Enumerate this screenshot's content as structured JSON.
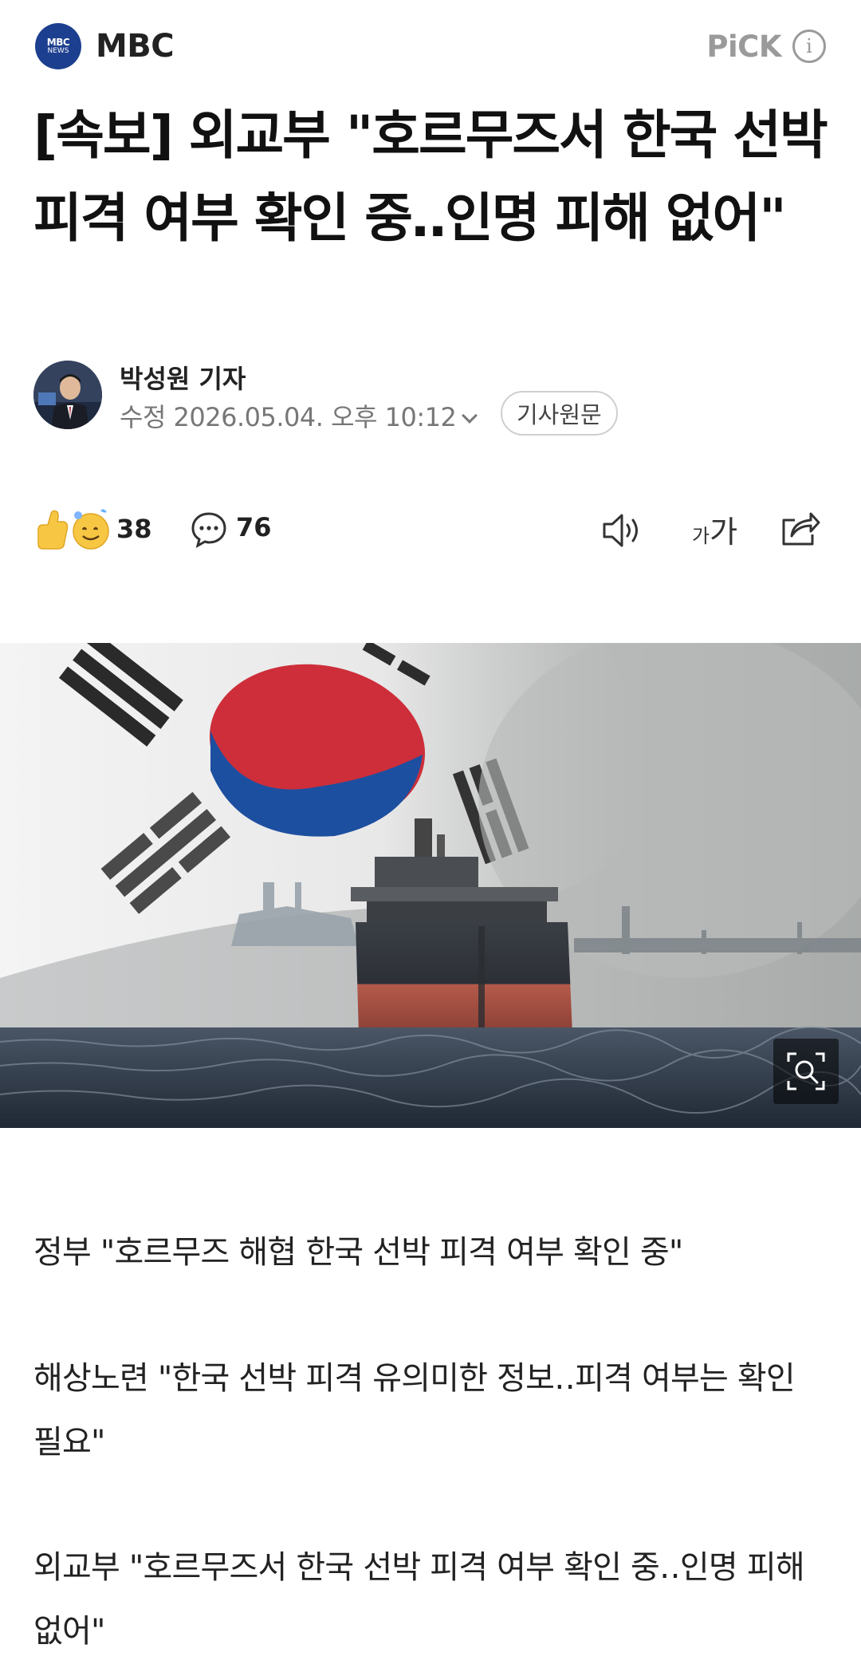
{
  "press": {
    "logo_line1": "MBC",
    "logo_line2": "NEWS",
    "name": "MBC",
    "pick_label": "PiCK",
    "info_glyph": "i",
    "brand_color": "#1d3f8f"
  },
  "article": {
    "headline": "[속보] 외교부 \"호르무즈서 한국 선박 피격 여부 확인 중‥인명 피해 없어\"",
    "reporter": "박성원 기자",
    "modified": "수정 2026.05.04. 오후 10:12",
    "original_button": "기사원문"
  },
  "actions": {
    "reaction_count": "38",
    "comment_count": "76",
    "font_small": "가",
    "font_large": "가"
  },
  "summary": [
    "정부 \"호르무즈 해협 한국 선박 피격 여부 확인 중\"",
    "해상노련 \"한국 선박 피격 유의미한 정보‥피격 여부는 확인 필요\"",
    "외교부 \"호르무즈서 한국 선박 피격 여부 확인 중‥인명 피해 없어\""
  ],
  "icons": {
    "reaction": "thumbs-up-and-smile-icon",
    "comment": "speech-bubble-icon",
    "tts": "speaker-icon",
    "font": "font-size-icon",
    "share": "share-icon",
    "zoom": "zoom-search-icon",
    "chevron": "chevron-down-icon",
    "info": "info-icon"
  }
}
